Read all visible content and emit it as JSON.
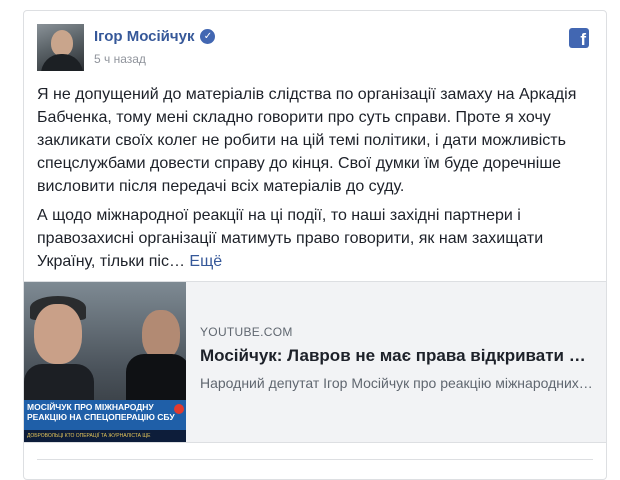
{
  "post": {
    "author": "Ігор Мосійчук",
    "timestamp": "5 ч назад",
    "paragraph1": "Я не допущений до матеріалів слідства по організації замаху на Аркадія Бабченка, тому мені складно говорити про суть справи. Проте я хочу закликати своїх колег не робити на цій темі політики, і дати можливість спецслужбами довести справу до кінця. Свої думки їм буде доречніше висловити після передачі всіх матеріалів до суду.",
    "paragraph2": "А щодо міжнародної реакції на ці події, то наші західні партнери і правозахисні організації матимуть право говорити, як нам захищати Україну, тільки піс…",
    "more_label": "Ещё"
  },
  "share": {
    "domain": "YOUTUBE.COM",
    "title": "Мосійчук: Лавров не має права відкривати рот…",
    "description": "Народний депутат Ігор Мосійчук про реакцію міжнародних…",
    "thumb_banner": "МОСІЙЧУК ПРО МІЖНАРОДНУ РЕАКЦІЮ НА СПЕЦОПЕРАЦІЮ СБУ",
    "thumb_ticker": "ДОБРОВОЛЬЦІ КТО ОПЕРАЦІЇ ТА ЖУРНАЛІСТА ЩЕ"
  },
  "icons": {
    "verified": "verified-badge-icon",
    "platform": "facebook-icon"
  },
  "colors": {
    "link": "#365899",
    "brand": "#4267b2",
    "text": "#1d2129",
    "muted": "#90949c"
  }
}
